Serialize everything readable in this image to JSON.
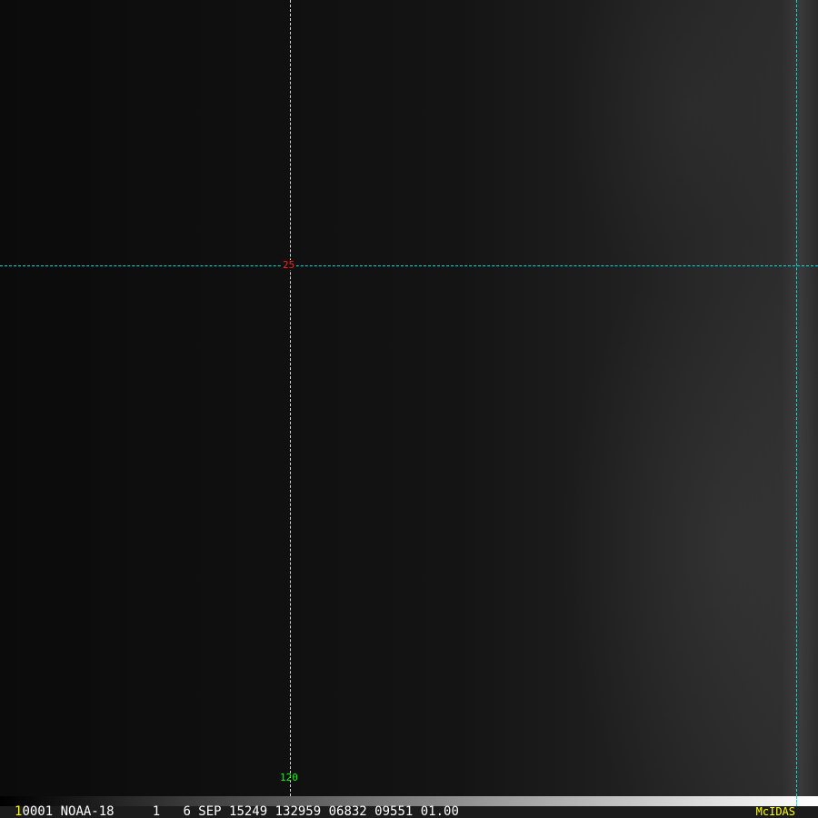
{
  "grid": {
    "lat_label": "25",
    "lon_label": "120",
    "lat_label_color": "#ff2020",
    "lon_label_color": "#00ff00",
    "grid_color": "#00e0e0",
    "meridian_color": "#e0e0e0"
  },
  "caption": {
    "frame_number": "1",
    "text": "0001 NOAA-18     1   6 SEP 15249 132959 06832 09551 01.00"
  },
  "logo": "McIDAS"
}
